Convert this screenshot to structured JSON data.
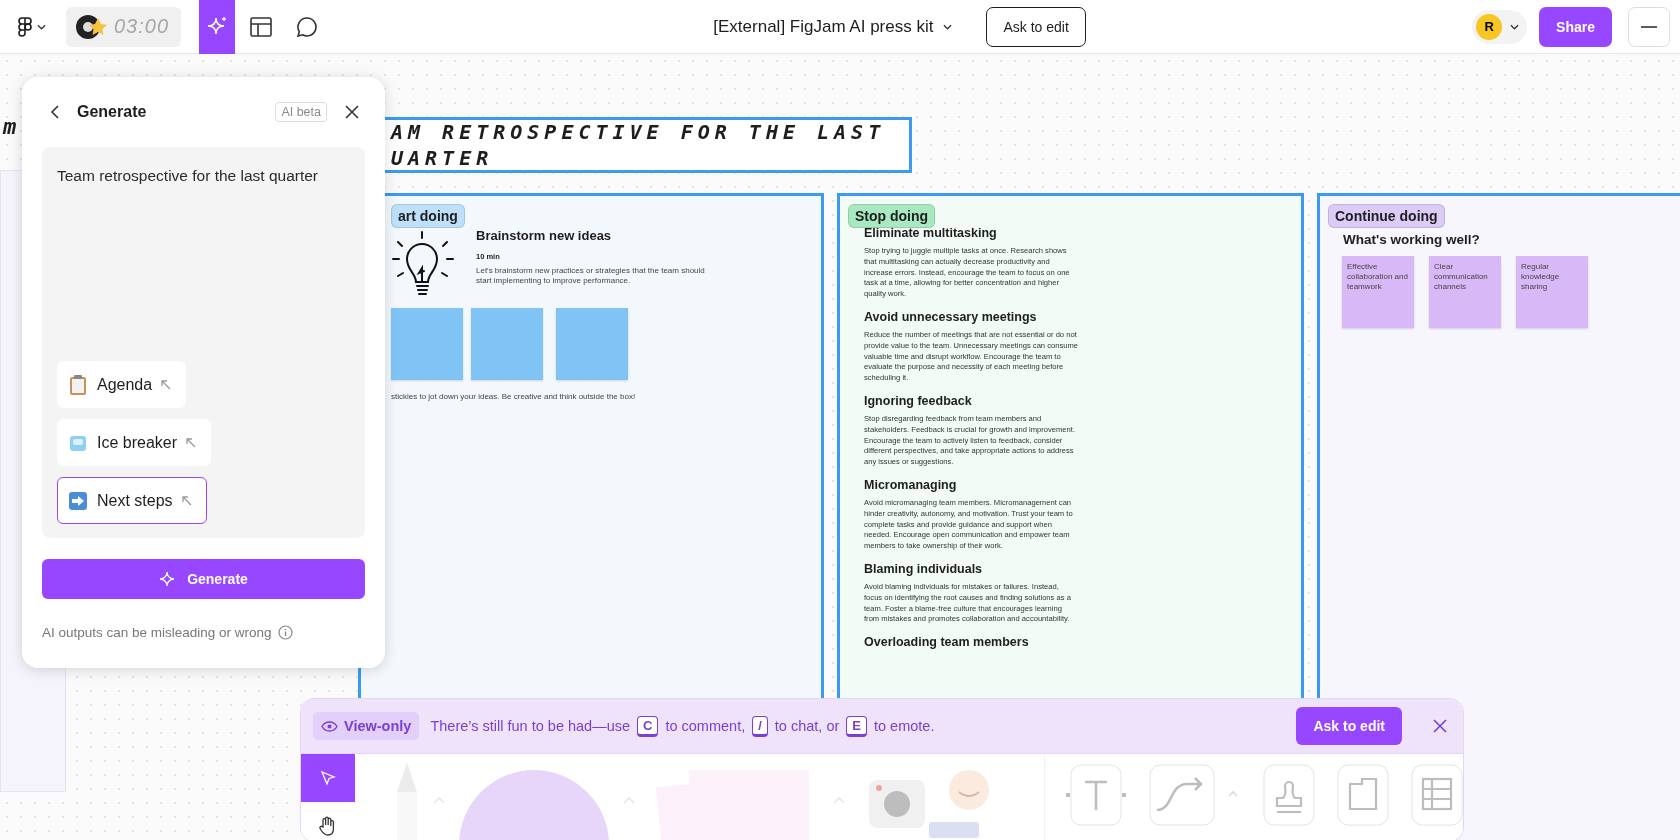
{
  "top_bar": {
    "timer": "03:00",
    "file_title": "[External] FigJam AI press kit",
    "ask_button": "Ask to edit",
    "avatar": "R",
    "share_button": "Share"
  },
  "left_fragment": "m",
  "generate_panel": {
    "title": "Generate",
    "badge": "AI beta",
    "prompt": "Team retrospective for the last quarter",
    "suggestions": [
      {
        "kind": "clipboard",
        "label": "Agenda",
        "selected": false
      },
      {
        "kind": "ice",
        "label": "Ice breaker",
        "selected": false
      },
      {
        "kind": "arrow",
        "label": "Next steps",
        "selected": true
      }
    ],
    "button": "Generate",
    "disclaimer": "AI outputs can be misleading or wrong"
  },
  "board": {
    "title_lines": [
      "AM RETROSPECTIVE FOR THE LAST",
      "UARTER"
    ],
    "columns": [
      {
        "kind": "activity",
        "tag": "art doing",
        "color": "#bfe0fa",
        "title": "Brainstorm new ideas",
        "duration": "10 min",
        "description": "Let's brainstorm new practices or strategies that the team should start implementing to improve performance.",
        "caption": "stickies to jot down your ideas. Be creative and think outside the box!"
      },
      {
        "kind": "sections",
        "tag": "Stop doing",
        "color": "#a9e9c2",
        "sections": [
          {
            "heading": "Eliminate multitasking",
            "body": "Stop trying to juggle multiple tasks at once. Research shows that multitasking can actually decrease productivity and increase errors. Instead, encourage the team to focus on one task at a time, allowing for better concentration and higher quality work."
          },
          {
            "heading": "Avoid unnecessary meetings",
            "body": "Reduce the number of meetings that are not essential or do not provide value to the team. Unnecessary meetings can consume valuable time and disrupt workflow. Encourage the team to evaluate the purpose and necessity of each meeting before scheduling it."
          },
          {
            "heading": "Ignoring feedback",
            "body": "Stop disregarding feedback from team members and stakeholders. Feedback is crucial for growth and improvement. Encourage the team to actively listen to feedback, consider different perspectives, and take appropriate actions to address any issues or suggestions."
          },
          {
            "heading": "Micromanaging",
            "body": "Avoid micromanaging team members. Micromanagement can hinder creativity, autonomy, and motivation. Trust your team to complete tasks and provide guidance and support when needed. Encourage open communication and empower team members to take ownership of their work."
          },
          {
            "heading": "Blaming individuals",
            "body": "Avoid blaming individuals for mistakes or failures. Instead, focus on identifying the root causes and finding solutions as a team. Foster a blame-free culture that encourages learning from mistakes and promotes collaboration and accountability."
          },
          {
            "heading": "Overloading team members"
          }
        ]
      },
      {
        "kind": "stickies",
        "tag": "Continue doing",
        "color": "#dccbf7",
        "heading": "What's working well?",
        "sticky_notes": [
          "Effective collaboration and teamwork",
          "Clear communication channels",
          "Regular knowledge sharing"
        ]
      }
    ]
  },
  "bottom_bar": {
    "badge": "View-only",
    "message": [
      {
        "kind": "text",
        "text": "There’s still fun to be had—use"
      },
      {
        "kind": "key",
        "text": "C"
      },
      {
        "kind": "text",
        "text": "to comment,"
      },
      {
        "kind": "key",
        "text": "/"
      },
      {
        "kind": "text",
        "text": "to chat, or"
      },
      {
        "kind": "key",
        "text": "E"
      },
      {
        "kind": "text",
        "text": "to emote."
      }
    ],
    "ask_button": "Ask to edit",
    "tools": [
      {
        "kind": "select",
        "selected": true
      },
      {
        "kind": "hand",
        "selected": false
      }
    ]
  }
}
